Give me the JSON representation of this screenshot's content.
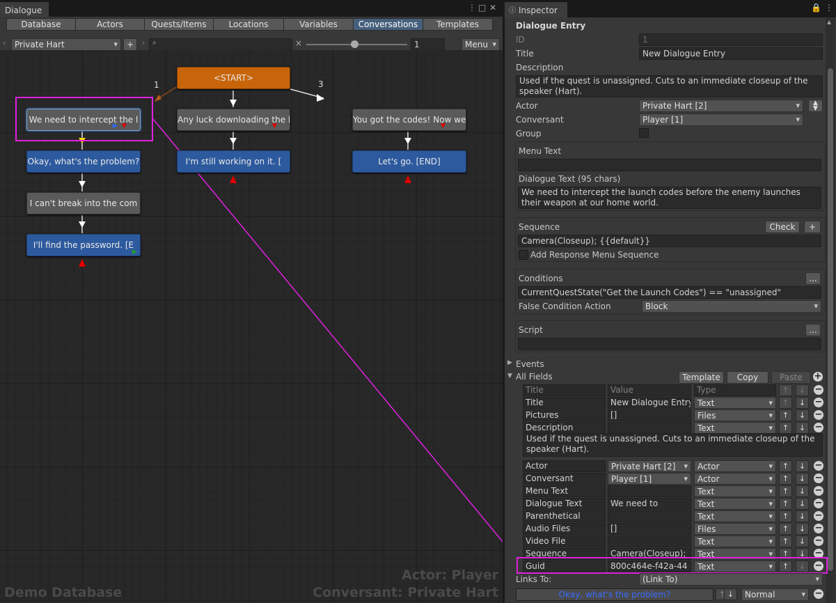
{
  "dialogue_window": {
    "tab_title": "Dialogue",
    "toolbar_tabs": [
      "Database",
      "Actors",
      "Quests/Items",
      "Locations",
      "Variables",
      "Conversations",
      "Templates"
    ],
    "active_tab": "Conversations",
    "conversation_select": "Private Hart",
    "add_label": "+",
    "search_placeholder": "",
    "clear_label": "×",
    "zoom_value": "1",
    "menu_label": "Menu",
    "footer_left": "Demo Database",
    "footer_actor": "Actor: Player",
    "footer_conversant": "Conversant: Private Hart",
    "link_label_1": "1",
    "link_label_3": "3",
    "nodes": {
      "start": "<START>",
      "n1": "We need to intercept the l",
      "n2": "Okay, what's the problem?",
      "n3": "I can't break into the com",
      "n4": "I'll find the password. [E",
      "n5": "Any luck downloading the l",
      "n6": "I'm still working on it. [",
      "n7": "You got the codes! Now we",
      "n8": "Let's go. [END]"
    }
  },
  "inspector": {
    "tab_title": "Inspector",
    "section_title": "Dialogue Entry",
    "id_label": "ID",
    "id_value": "1",
    "title_label": "Title",
    "title_value": "New Dialogue Entry",
    "description_label": "Description",
    "description_value": "Used if the quest is unassigned. Cuts to an immediate closeup of the speaker (Hart).",
    "actor_label": "Actor",
    "actor_value": "Private Hart [2]",
    "conversant_label": "Conversant",
    "conversant_value": "Player [1]",
    "group_label": "Group",
    "menu_text_label": "Menu Text",
    "menu_text_value": "",
    "dialogue_text_label": "Dialogue Text (95 chars)",
    "dialogue_text_value": "We need to intercept the launch codes before the enemy launches their weapon at our home world.",
    "sequence_label": "Sequence",
    "check_label": "Check",
    "plus_label": "+",
    "sequence_value": "Camera(Closeup); {{default}}",
    "add_response_label": "Add Response Menu Sequence",
    "conditions_label": "Conditions",
    "ellipsis_label": "...",
    "conditions_value": "CurrentQuestState(\"Get the Launch Codes\") == \"unassigned\"",
    "false_condition_label": "False Condition Action",
    "false_condition_value": "Block",
    "script_label": "Script",
    "script_value": "",
    "events_label": "Events",
    "all_fields_label": "All Fields",
    "template_label": "Template",
    "copy_label": "Copy",
    "paste_label": "Paste",
    "col_title": "Title",
    "col_value": "Value",
    "col_type": "Type",
    "fields": [
      {
        "title": "Title",
        "value": "New Dialogue Entry",
        "type": "Text",
        "value_dd": false
      },
      {
        "title": "Pictures",
        "value": "[]",
        "type": "Files",
        "value_dd": false
      },
      {
        "title": "Description",
        "value": "",
        "type": "Text",
        "value_dd": false
      },
      {
        "title": "Actor",
        "value": "Private Hart [2]",
        "type": "Actor",
        "value_dd": true
      },
      {
        "title": "Conversant",
        "value": "Player [1]",
        "type": "Actor",
        "value_dd": true
      },
      {
        "title": "Menu Text",
        "value": "",
        "type": "Text",
        "value_dd": false
      },
      {
        "title": "Dialogue Text",
        "value": "We need to",
        "type": "Text",
        "value_dd": false
      },
      {
        "title": "Parenthetical",
        "value": "",
        "type": "Text",
        "value_dd": false
      },
      {
        "title": "Audio Files",
        "value": "[]",
        "type": "Files",
        "value_dd": false
      },
      {
        "title": "Video File",
        "value": "",
        "type": "Text",
        "value_dd": false
      },
      {
        "title": "Sequence",
        "value": "Camera(Closeup);",
        "type": "Text",
        "value_dd": false
      },
      {
        "title": "Guid",
        "value": "800c464e-f42a-44",
        "type": "Text",
        "value_dd": false
      }
    ],
    "description_expanded": "Used if the quest is unassigned. Cuts to an immediate closeup of the speaker (Hart).",
    "links_to_label": "Links To:",
    "links_to_value": "(Link To)",
    "link_entry": "Okay, what's the problem?",
    "link_priority": "Normal"
  },
  "colors": {
    "highlight": "#e020e0",
    "node_blue": "#2d5a9e",
    "node_gray": "#5a5a5a",
    "node_orange": "#c8650a",
    "selected_tab": "#46607c"
  }
}
